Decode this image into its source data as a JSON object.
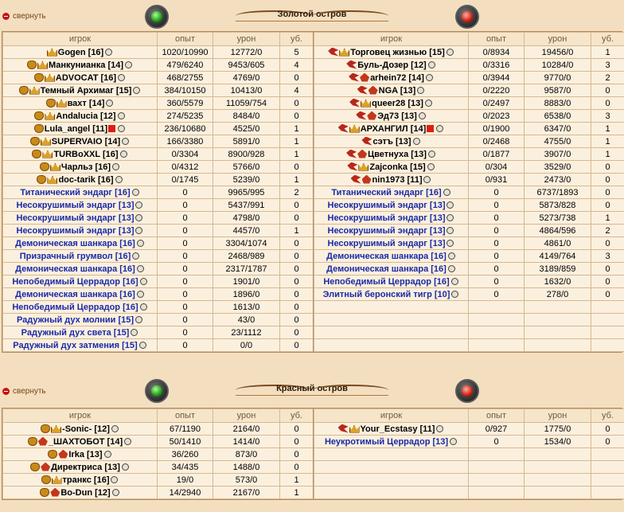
{
  "collapse_label": "свернуть",
  "islands": [
    {
      "title": "Золотой остров",
      "headers": [
        "игрок",
        "опыт",
        "урон",
        "уб."
      ],
      "teams": [
        {
          "color": "green",
          "rows": [
            {
              "name": "Gogen [16]",
              "exp": "1020/10990",
              "dmg": "12772/0",
              "kills": "5",
              "type": "player",
              "icons": [
                "crown"
              ]
            },
            {
              "name": "Манкунианка [14]",
              "exp": "479/6240",
              "dmg": "9453/605",
              "kills": "4",
              "type": "player",
              "icons": [
                "medal",
                "crown"
              ]
            },
            {
              "name": "ADVOCAT [16]",
              "exp": "468/2755",
              "dmg": "4769/0",
              "kills": "0",
              "type": "player",
              "icons": [
                "medal",
                "crown"
              ]
            },
            {
              "name": "Темный Архимаг [15]",
              "exp": "384/10150",
              "dmg": "10413/0",
              "kills": "4",
              "type": "player",
              "icons": [
                "medal",
                "crown"
              ]
            },
            {
              "name": "вахт [14]",
              "exp": "360/5579",
              "dmg": "11059/754",
              "kills": "0",
              "type": "player",
              "icons": [
                "medal",
                "crown"
              ]
            },
            {
              "name": "Andalucia [12]",
              "exp": "274/5235",
              "dmg": "8484/0",
              "kills": "0",
              "type": "player",
              "icons": [
                "medal",
                "crown"
              ]
            },
            {
              "name": "Lula_angel [11]",
              "exp": "236/10680",
              "dmg": "4525/0",
              "kills": "1",
              "type": "player",
              "icons": [
                "medal"
              ],
              "redcross": true
            },
            {
              "name": "SUPERVAIO [14]",
              "exp": "166/3380",
              "dmg": "5891/0",
              "kills": "1",
              "type": "player",
              "icons": [
                "medal",
                "crown"
              ]
            },
            {
              "name": "TURBoXXL [16]",
              "exp": "0/3304",
              "dmg": "8900/928",
              "kills": "1",
              "type": "player",
              "icons": [
                "medal",
                "crown"
              ]
            },
            {
              "name": "Чарльз [16]",
              "exp": "0/4312",
              "dmg": "5766/0",
              "kills": "0",
              "type": "player",
              "icons": [
                "medal",
                "crown"
              ]
            },
            {
              "name": "doc-tarik [16]",
              "exp": "0/1745",
              "dmg": "5239/0",
              "kills": "1",
              "type": "player",
              "icons": [
                "medal",
                "crown"
              ]
            },
            {
              "name": "Титанический эндарг [16]",
              "exp": "0",
              "dmg": "9965/995",
              "kills": "2",
              "type": "bot",
              "icons": []
            },
            {
              "name": "Несокрушимый эндарг [13]",
              "exp": "0",
              "dmg": "5437/991",
              "kills": "0",
              "type": "bot",
              "icons": []
            },
            {
              "name": "Несокрушимый эндарг [13]",
              "exp": "0",
              "dmg": "4798/0",
              "kills": "0",
              "type": "bot",
              "icons": []
            },
            {
              "name": "Несокрушимый эндарг [13]",
              "exp": "0",
              "dmg": "4457/0",
              "kills": "1",
              "type": "bot",
              "icons": []
            },
            {
              "name": "Демоническая шанкара [16]",
              "exp": "0",
              "dmg": "3304/1074",
              "kills": "0",
              "type": "bot",
              "icons": []
            },
            {
              "name": "Призрачный грумвол [16]",
              "exp": "0",
              "dmg": "2468/989",
              "kills": "0",
              "type": "bot",
              "icons": []
            },
            {
              "name": "Демоническая шанкара [16]",
              "exp": "0",
              "dmg": "2317/1787",
              "kills": "0",
              "type": "bot",
              "icons": []
            },
            {
              "name": "Непобедимый Церрадор [16]",
              "exp": "0",
              "dmg": "1901/0",
              "kills": "0",
              "type": "bot",
              "icons": []
            },
            {
              "name": "Демоническая шанкара [16]",
              "exp": "0",
              "dmg": "1896/0",
              "kills": "0",
              "type": "bot",
              "icons": []
            },
            {
              "name": "Непобедимый Церрадор [16]",
              "exp": "0",
              "dmg": "1613/0",
              "kills": "0",
              "type": "bot",
              "icons": []
            },
            {
              "name": "Радужный дух молнии [15]",
              "exp": "0",
              "dmg": "43/0",
              "kills": "0",
              "type": "bot",
              "icons": []
            },
            {
              "name": "Радужный дух света [15]",
              "exp": "0",
              "dmg": "23/1112",
              "kills": "0",
              "type": "bot",
              "icons": []
            },
            {
              "name": "Радужный дух затмения [15]",
              "exp": "0",
              "dmg": "0/0",
              "kills": "0",
              "type": "bot",
              "icons": []
            }
          ]
        },
        {
          "color": "red",
          "rows": [
            {
              "name": "Торговец жизнью [15]",
              "exp": "0/8934",
              "dmg": "19456/0",
              "kills": "1",
              "type": "player",
              "icons": [
                "bird",
                "crown"
              ]
            },
            {
              "name": "Буль-Дозер [12]",
              "exp": "0/3316",
              "dmg": "10284/0",
              "kills": "3",
              "type": "player",
              "icons": [
                "bird"
              ]
            },
            {
              "name": "arhein72 [14]",
              "exp": "0/3944",
              "dmg": "9770/0",
              "kills": "2",
              "type": "player",
              "icons": [
                "bird",
                "dragon"
              ]
            },
            {
              "name": "NGA [13]",
              "exp": "0/2220",
              "dmg": "9587/0",
              "kills": "0",
              "type": "player",
              "icons": [
                "bird",
                "dragon"
              ]
            },
            {
              "name": "queer28 [13]",
              "exp": "0/2497",
              "dmg": "8883/0",
              "kills": "0",
              "type": "player",
              "icons": [
                "bird",
                "crown"
              ]
            },
            {
              "name": "Эд73 [13]",
              "exp": "0/2023",
              "dmg": "6538/0",
              "kills": "3",
              "type": "player",
              "icons": [
                "bird",
                "dragon"
              ]
            },
            {
              "name": "АРХАНГИЛ [14]",
              "exp": "0/1900",
              "dmg": "6347/0",
              "kills": "1",
              "type": "player",
              "icons": [
                "bird",
                "crown"
              ],
              "redcross": true
            },
            {
              "name": "сэтъ [13]",
              "exp": "0/2468",
              "dmg": "4755/0",
              "kills": "1",
              "type": "player",
              "icons": [
                "bird"
              ]
            },
            {
              "name": "Цветнуха [13]",
              "exp": "0/1877",
              "dmg": "3907/0",
              "kills": "1",
              "type": "player",
              "icons": [
                "bird",
                "dragon"
              ]
            },
            {
              "name": "Zajconka [15]",
              "exp": "0/304",
              "dmg": "3529/0",
              "kills": "0",
              "type": "player",
              "icons": [
                "bird",
                "crown"
              ]
            },
            {
              "name": "nin1973 [11]",
              "exp": "0/931",
              "dmg": "2473/0",
              "kills": "0",
              "type": "player",
              "icons": [
                "bird",
                "dragon"
              ]
            },
            {
              "name": "Титанический эндарг [16]",
              "exp": "0",
              "dmg": "6737/1893",
              "kills": "0",
              "type": "bot",
              "icons": []
            },
            {
              "name": "Несокрушимый эндарг [13]",
              "exp": "0",
              "dmg": "5873/828",
              "kills": "0",
              "type": "bot",
              "icons": []
            },
            {
              "name": "Несокрушимый эндарг [13]",
              "exp": "0",
              "dmg": "5273/738",
              "kills": "1",
              "type": "bot",
              "icons": []
            },
            {
              "name": "Несокрушимый эндарг [13]",
              "exp": "0",
              "dmg": "4864/596",
              "kills": "2",
              "type": "bot",
              "icons": []
            },
            {
              "name": "Несокрушимый эндарг [13]",
              "exp": "0",
              "dmg": "4861/0",
              "kills": "0",
              "type": "bot",
              "icons": []
            },
            {
              "name": "Демоническая шанкара [16]",
              "exp": "0",
              "dmg": "4149/764",
              "kills": "3",
              "type": "bot",
              "icons": []
            },
            {
              "name": "Демоническая шанкара [16]",
              "exp": "0",
              "dmg": "3189/859",
              "kills": "0",
              "type": "bot",
              "icons": []
            },
            {
              "name": "Непобедимый Церрадор [16]",
              "exp": "0",
              "dmg": "1632/0",
              "kills": "0",
              "type": "bot",
              "icons": []
            },
            {
              "name": "Элитный беронский тигр [10]",
              "exp": "0",
              "dmg": "278/0",
              "kills": "0",
              "type": "bot",
              "icons": []
            }
          ]
        }
      ]
    },
    {
      "title": "Красный остров",
      "headers": [
        "игрок",
        "опыт",
        "урон",
        "уб."
      ],
      "teams": [
        {
          "color": "green",
          "rows": [
            {
              "name": "-Sonic- [12]",
              "exp": "67/1190",
              "dmg": "2164/0",
              "kills": "0",
              "type": "player",
              "icons": [
                "medal",
                "crown"
              ]
            },
            {
              "name": "_ШАХТОБОТ [14]",
              "exp": "50/1410",
              "dmg": "1414/0",
              "kills": "0",
              "type": "player",
              "icons": [
                "medal",
                "dragon"
              ]
            },
            {
              "name": "Irka [13]",
              "exp": "36/260",
              "dmg": "873/0",
              "kills": "0",
              "type": "player",
              "icons": [
                "medal",
                "dragon"
              ]
            },
            {
              "name": "Директриса [13]",
              "exp": "34/435",
              "dmg": "1488/0",
              "kills": "0",
              "type": "player",
              "icons": [
                "medal",
                "dragon"
              ]
            },
            {
              "name": "транкс [16]",
              "exp": "19/0",
              "dmg": "573/0",
              "kills": "1",
              "type": "player",
              "icons": [
                "medal",
                "crown"
              ]
            },
            {
              "name": "Bo-Dun [12]",
              "exp": "14/2940",
              "dmg": "2167/0",
              "kills": "1",
              "type": "player",
              "icons": [
                "medal",
                "dragon"
              ]
            }
          ]
        },
        {
          "color": "red",
          "rows": [
            {
              "name": "Your_Ecstasy [11]",
              "exp": "0/927",
              "dmg": "1775/0",
              "kills": "0",
              "type": "player",
              "icons": [
                "bird",
                "crown"
              ]
            },
            {
              "name": "Неукротимый Церрадор [13]",
              "exp": "0",
              "dmg": "1534/0",
              "kills": "0",
              "type": "bot",
              "icons": []
            }
          ]
        }
      ]
    }
  ]
}
